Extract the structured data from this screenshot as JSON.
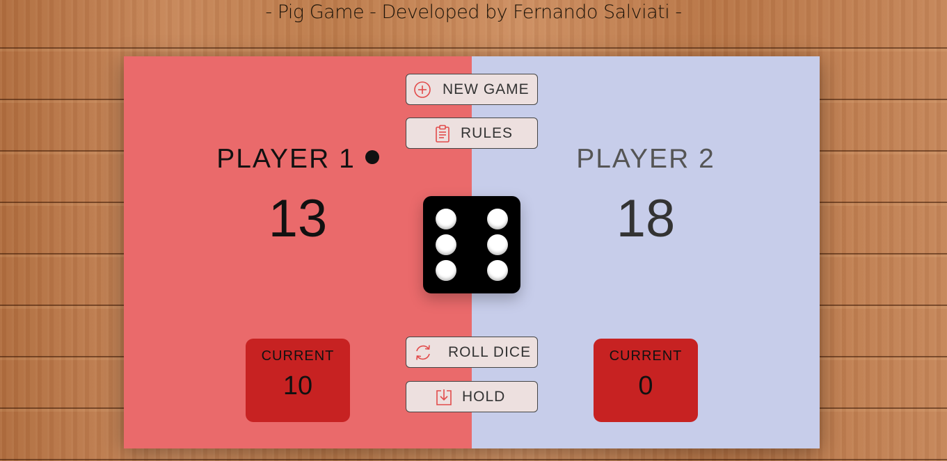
{
  "title": "- Pig Game - Developed by Fernando Salviati -",
  "players": [
    {
      "name": "PLAYER 1",
      "score": "13",
      "current_label": "CURRENT",
      "current_score": "10",
      "active": true
    },
    {
      "name": "PLAYER 2",
      "score": "18",
      "current_label": "CURRENT",
      "current_score": "0",
      "active": false
    }
  ],
  "buttons": {
    "new_game": {
      "label": "NEW GAME",
      "icon": "plus-circle-icon"
    },
    "rules": {
      "label": "RULES",
      "icon": "clipboard-icon"
    },
    "roll_dice": {
      "label": "ROLL DICE",
      "icon": "refresh-icon"
    },
    "hold": {
      "label": "HOLD",
      "icon": "download-icon"
    }
  },
  "dice": {
    "value": 6
  },
  "colors": {
    "player1_bg": "#ea6a6b",
    "player2_bg": "#c7cdea",
    "current_box": "#c72222",
    "icon_accent": "#e24a4a"
  }
}
